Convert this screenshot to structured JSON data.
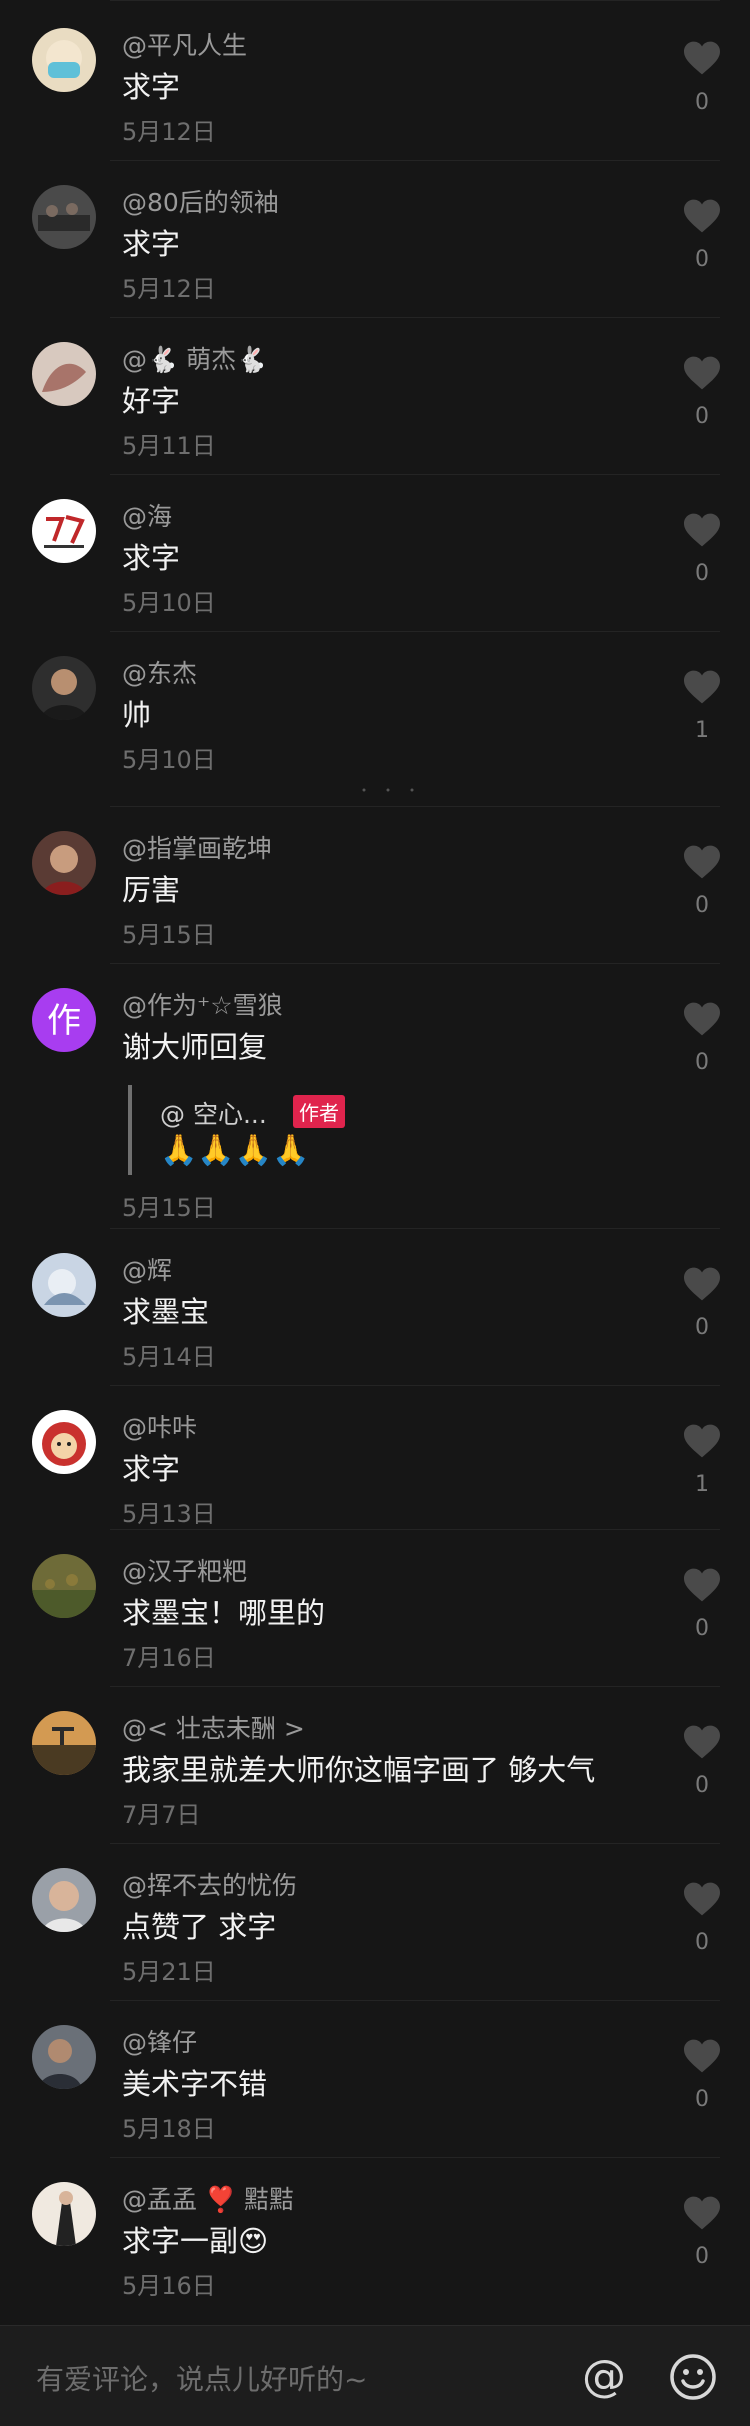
{
  "comments": [
    {
      "user": "@平凡人生",
      "text": "求字",
      "date": "5月12日",
      "likes": "0",
      "avatar_color": "#e9dcc2"
    },
    {
      "user": "@80后的领袖",
      "text": "求字",
      "date": "5月12日",
      "likes": "0",
      "avatar_color": "#4a4a4a"
    },
    {
      "user": "@🐇 萌杰🐇",
      "text": "好字",
      "date": "5月11日",
      "likes": "0",
      "avatar_color": "#a8746a"
    },
    {
      "user": "@海",
      "text": "求字",
      "date": "5月10日",
      "likes": "0",
      "avatar_color": "#ffffff"
    },
    {
      "user": "@东杰",
      "text": "帅",
      "date": "5月10日",
      "likes": "1",
      "avatar_color": "#2e2e2e"
    },
    {
      "user": "@指掌画乾坤",
      "text": "厉害",
      "date": "5月15日",
      "likes": "0",
      "avatar_color": "#5a3b34"
    },
    {
      "user": "@作为⁺☆雪狼",
      "text": "谢大师回复",
      "date": "5月15日",
      "likes": "0",
      "avatar_color": "#a83df0",
      "avatar_letter": "作",
      "reply": {
        "user": "@  空心...",
        "badge": "作者",
        "text": "🙏🙏🙏🙏"
      }
    },
    {
      "user": "@辉",
      "text": "求墨宝",
      "date": "5月14日",
      "likes": "0",
      "avatar_color": "#c9d5e4"
    },
    {
      "user": "@咔咔",
      "text": "求字",
      "date": "5月13日",
      "likes": "1",
      "avatar_color": "#c9312e"
    },
    {
      "user": "@汉子粑粑",
      "text": "求墨宝！哪里的",
      "date": "7月16日",
      "likes": "0",
      "avatar_color": "#6e6b38"
    },
    {
      "user": "@< 壮志未酬 >",
      "text": "我家里就差大师你这幅字画了  够大气",
      "date": "7月7日",
      "likes": "0",
      "avatar_color": "#b07a3a"
    },
    {
      "user": "@挥不去的忧伤",
      "text": "点赞了 求字",
      "date": "5月21日",
      "likes": "0",
      "avatar_color": "#9aa0a8"
    },
    {
      "user": "@锋仔",
      "text": "美术字不错",
      "date": "5月18日",
      "likes": "0",
      "avatar_color": "#6a7078"
    },
    {
      "user": "@孟孟 ❣️ 黠黠",
      "text": "求字一副😍",
      "date": "5月16日",
      "likes": "0",
      "avatar_color": "#f0e9e0"
    }
  ],
  "input_bar": {
    "placeholder": "有爱评论，说点儿好听的~",
    "at_symbol": "@",
    "at_icon": "at-icon",
    "emoji_icon": "smiley-icon"
  },
  "colors": {
    "background": "#161616",
    "username": "#9a9a9a",
    "text": "#f2f2f2",
    "date": "#6e6e6e",
    "author_badge": "#e0244d"
  }
}
